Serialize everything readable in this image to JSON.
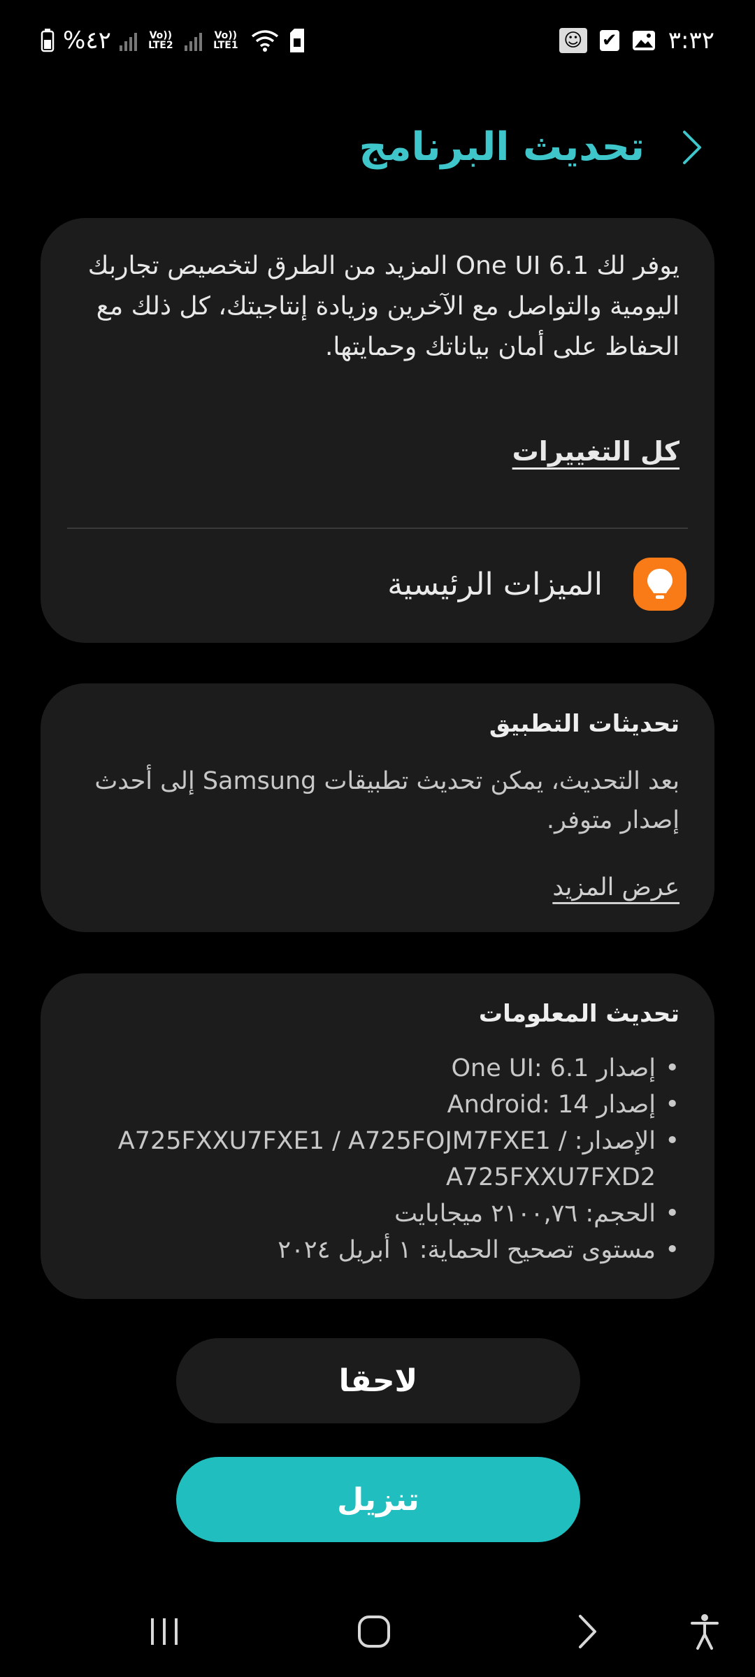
{
  "status_bar": {
    "time": "٣:٣٢",
    "battery": "%٤٢",
    "sim2_label": "Vo)) LTE2",
    "sim1_label": "Vo)) LTE1"
  },
  "header": {
    "title": "تحديث البرنامج"
  },
  "update_card": {
    "description": "يوفر لك One UI 6.1 المزيد من الطرق لتخصيص تجاربك اليومية والتواصل مع الآخرين وزيادة إنتاجيتك، كل ذلك مع الحفاظ على أمان بياناتك وحمايتها.",
    "all_changes_link": "كل التغييرات",
    "key_features_label": "الميزات الرئيسية"
  },
  "app_updates_card": {
    "title": "تحديثات التطبيق",
    "body": "بعد التحديث، يمكن تحديث تطبيقات Samsung إلى أحدث إصدار متوفر.",
    "more_link": "عرض المزيد"
  },
  "info_card": {
    "title": "تحديث المعلومات",
    "items": [
      "إصدار One UI: 6.1",
      "إصدار Android: 14",
      "الإصدار: A725FXXU7FXE1 / A725FOJM7FXE1 / A725FXXU7FXD2",
      "الحجم: ٢١٠٠,٧٦ ميجابايت",
      "مستوى تصحيح الحماية: ١ أبريل ٢٠٢٤"
    ]
  },
  "buttons": {
    "later": "لاحقا",
    "download": "تنزيل"
  },
  "colors": {
    "accent": "#3fc6cb",
    "download_button": "#21bebf",
    "feature_icon_bg": "#f97b17",
    "card_bg": "#1c1c1c",
    "background": "#000000"
  },
  "icons": {
    "back": "chevron-right-icon",
    "feature": "lightbulb-icon",
    "nav_recents": "recents-icon",
    "nav_home": "home-icon",
    "nav_back": "back-icon",
    "nav_accessibility": "accessibility-icon"
  }
}
